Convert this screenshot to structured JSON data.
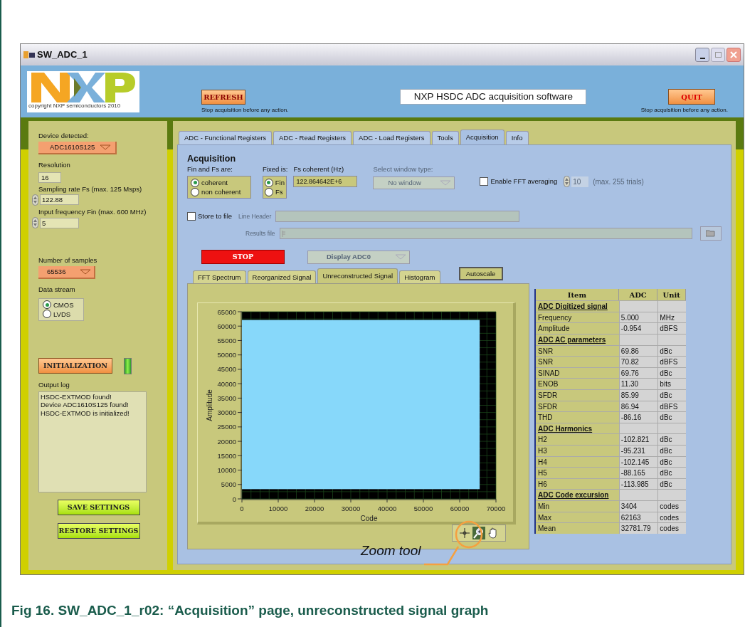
{
  "window": {
    "title": "SW_ADC_1"
  },
  "header": {
    "logo_caption": "copyright NXP semiconductors 2010",
    "refresh": {
      "label": "REFRESH",
      "note": "Stop acquisition before any action."
    },
    "app_title": "NXP HSDC ADC acquisition software",
    "quit": {
      "label": "QUIT",
      "note": "Stop acquisition before any action."
    }
  },
  "sidebar": {
    "device": {
      "label": "Device detected:",
      "value": "ADC1610S125"
    },
    "resolution": {
      "label": "Resolution",
      "value": "16"
    },
    "sampling_rate": {
      "label": "Sampling rate Fs (max. 125 Msps)",
      "value": "122.88"
    },
    "input_frequency": {
      "label": "Input frequency Fin (max. 600 MHz)",
      "value": "5"
    },
    "samples": {
      "label": "Number of samples",
      "value": "65536"
    },
    "data_stream": {
      "label": "Data stream",
      "options": [
        {
          "label": "CMOS",
          "selected": true
        },
        {
          "label": "LVDS",
          "selected": false
        }
      ]
    },
    "initialization": {
      "label": "INITIALIZATION",
      "led_on": true
    },
    "output_log": {
      "label": "Output log",
      "lines": [
        "HSDC-EXTMOD found!",
        "Device ADC1610S125 found!",
        "HSDC-EXTMOD is initialized!"
      ]
    },
    "buttons": [
      "SAVE SETTINGS",
      "RESTORE SETTINGS"
    ]
  },
  "tabs": [
    {
      "label": "ADC - Functional Registers",
      "selected": false
    },
    {
      "label": "ADC - Read Registers",
      "selected": false
    },
    {
      "label": "ADC - Load Registers",
      "selected": false
    },
    {
      "label": "Tools",
      "selected": false
    },
    {
      "label": "Acquisition",
      "selected": true
    },
    {
      "label": "Info",
      "selected": false
    }
  ],
  "acquisition": {
    "title": "Acquisition",
    "fin_fs": {
      "label": "Fin and Fs are:",
      "options": [
        {
          "label": "coherent",
          "selected": true
        },
        {
          "label": "non coherent",
          "selected": false
        }
      ]
    },
    "fixed": {
      "label": "Fixed is:",
      "options": [
        {
          "label": "Fin",
          "selected": true
        },
        {
          "label": "Fs",
          "selected": false
        }
      ]
    },
    "fs_coherent": {
      "label": "Fs coherent (Hz)",
      "value": "122.864642E+6"
    },
    "window_type": {
      "label": "Select window type:",
      "value": "No window",
      "disabled": true
    },
    "fft_averaging": {
      "label": "Enable FFT averaging",
      "checked": false,
      "value": "10",
      "note": "(max. 255 trials)",
      "disabled": true
    },
    "store_to_file": {
      "label": "Store to file",
      "checked": false
    },
    "line_header": {
      "label": "Line Header",
      "disabled": true
    },
    "results_file": {
      "label": "Results file",
      "disabled": true
    },
    "stop": {
      "label": "STOP"
    },
    "display": {
      "value": "Display ADC0",
      "disabled": true
    }
  },
  "graph_tabs": [
    {
      "label": "FFT Spectrum",
      "selected": false
    },
    {
      "label": "Reorganized Signal",
      "selected": false
    },
    {
      "label": "Unreconstructed Signal",
      "selected": true
    },
    {
      "label": "Histogram",
      "selected": false
    }
  ],
  "autoscale": "Autoscale",
  "graph": {
    "xlabel": "Code",
    "ylabel": "Amplitude",
    "xticks": [
      "0",
      "10000",
      "20000",
      "30000",
      "40000",
      "50000",
      "60000",
      "70000"
    ],
    "yticks": [
      "65000",
      "60000",
      "55000",
      "50000",
      "45000",
      "40000",
      "35000",
      "30000",
      "25000",
      "20000",
      "15000",
      "10000",
      "5000",
      "0"
    ]
  },
  "results": {
    "columns": [
      "Item",
      "ADC",
      "Unit"
    ],
    "rows": [
      {
        "kind": "section",
        "item": "ADC Digitized signal"
      },
      {
        "kind": "data",
        "item": "Frequency",
        "value": "5.000",
        "unit": "MHz"
      },
      {
        "kind": "data",
        "item": "Amplitude",
        "value": "-0.954",
        "unit": "dBFS"
      },
      {
        "kind": "section",
        "item": "ADC AC parameters"
      },
      {
        "kind": "data",
        "item": "SNR",
        "value": "69.86",
        "unit": "dBc"
      },
      {
        "kind": "data",
        "item": "SNR",
        "value": "70.82",
        "unit": "dBFS"
      },
      {
        "kind": "data",
        "item": "SINAD",
        "value": "69.76",
        "unit": "dBc"
      },
      {
        "kind": "data",
        "item": "ENOB",
        "value": "11.30",
        "unit": "bits"
      },
      {
        "kind": "data",
        "item": "SFDR",
        "value": "85.99",
        "unit": "dBc"
      },
      {
        "kind": "data",
        "item": "SFDR",
        "value": "86.94",
        "unit": "dBFS"
      },
      {
        "kind": "data",
        "item": "THD",
        "value": "-86.16",
        "unit": "dBc"
      },
      {
        "kind": "section",
        "item": "ADC Harmonics"
      },
      {
        "kind": "data",
        "item": "H2",
        "value": "-102.821",
        "unit": "dBc"
      },
      {
        "kind": "data",
        "item": "H3",
        "value": "-95.231",
        "unit": "dBc"
      },
      {
        "kind": "data",
        "item": "H4",
        "value": "-102.145",
        "unit": "dBc"
      },
      {
        "kind": "data",
        "item": "H5",
        "value": "-88.165",
        "unit": "dBc"
      },
      {
        "kind": "data",
        "item": "H6",
        "value": "-113.985",
        "unit": "dBc"
      },
      {
        "kind": "section",
        "item": "ADC Code excursion"
      },
      {
        "kind": "data",
        "item": "Min",
        "value": "3404",
        "unit": "codes"
      },
      {
        "kind": "data",
        "item": "Max",
        "value": "62163",
        "unit": "codes"
      },
      {
        "kind": "data",
        "item": "Mean",
        "value": "32781.79",
        "unit": "codes"
      }
    ]
  },
  "callout": "Zoom tool",
  "caption": "Fig 16. SW_ADC_1_r02: “Acquisition” page, unreconstructed signal graph"
}
